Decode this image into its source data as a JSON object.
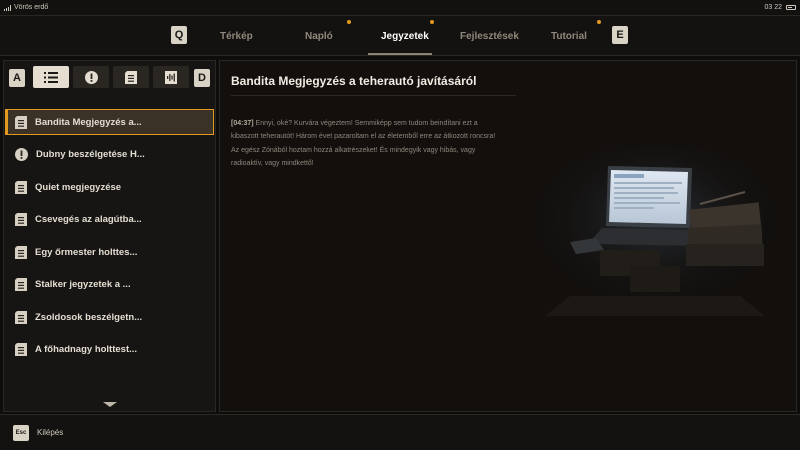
{
  "status": {
    "location": "Vörös erdő",
    "time": "03 22"
  },
  "nav": {
    "left_key": "Q",
    "right_key": "E",
    "tabs": [
      {
        "label": "Térkép",
        "active": false,
        "has_dot": false
      },
      {
        "label": "Napló",
        "active": false,
        "has_dot": true
      },
      {
        "label": "Jegyzetek",
        "active": true,
        "has_dot": true
      },
      {
        "label": "Fejlesztések",
        "active": false,
        "has_dot": false
      },
      {
        "label": "Tutorial",
        "active": false,
        "has_dot": true
      }
    ],
    "dot_color": "#e19a1e"
  },
  "filters": {
    "left_key": "A",
    "right_key": "D",
    "buttons": [
      {
        "icon": "list-icon",
        "active": true
      },
      {
        "icon": "exclamation-icon",
        "active": false
      },
      {
        "icon": "note-icon",
        "active": false
      },
      {
        "icon": "audio-note-icon",
        "active": false
      }
    ]
  },
  "notes": [
    {
      "label": "Bandita Megjegyzés a...",
      "icon": "note-icon",
      "selected": true
    },
    {
      "label": "Dubny beszélgetése H...",
      "icon": "exclamation-icon",
      "selected": false
    },
    {
      "label": "Quiet megjegyzése",
      "icon": "note-icon",
      "selected": false
    },
    {
      "label": "Csevegés az alagútba...",
      "icon": "note-icon",
      "selected": false
    },
    {
      "label": "Egy őrmester holttes...",
      "icon": "note-icon",
      "selected": false
    },
    {
      "label": "Stalker jegyzetek a ...",
      "icon": "note-icon",
      "selected": false
    },
    {
      "label": "Zsoldosok beszélgetn...",
      "icon": "note-icon",
      "selected": false
    },
    {
      "label": "A főhadnagy holttest...",
      "icon": "note-icon",
      "selected": false
    }
  ],
  "detail": {
    "title": "Bandita Megjegyzés a teherautó javításáról",
    "timestamp": "[04:37]",
    "body": " Ennyi, oké? Kurvára végeztem! Semmiképp sem tudom beindítani ezt a kibaszott teherautót! Három évet pazaroltam el az életemből erre az átkozott roncsra! Az egész Zónából hoztam hozzá alkatrészeket! És mindegyik vagy hibás, vagy radioaktív, vagy mindkettő!"
  },
  "footer": {
    "esc_key": "Esc",
    "exit_label": "Kilépés"
  },
  "colors": {
    "accent": "#e19a1e",
    "keycap": "#d9d3c6"
  }
}
